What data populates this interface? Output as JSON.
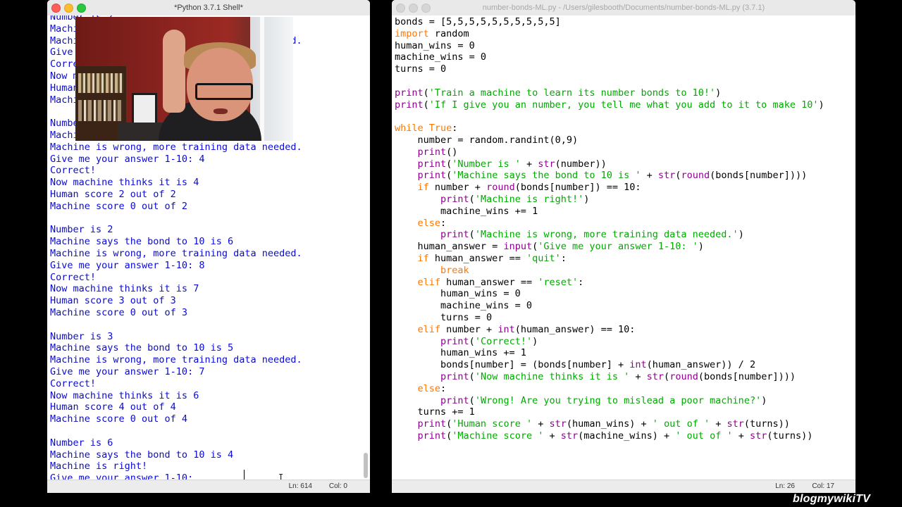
{
  "shell": {
    "title": "*Python 3.7.1 Shell*",
    "lines": [
      "Number is 2",
      "Machine says the bond to 10 is 5",
      "Machine is wrong, more training data needed.",
      "Give me your answer 1-10: 6",
      "Correct!",
      "Now machine thinks it is 6",
      "Human score 1 out of 1",
      "Machine score 0 out of 1",
      "",
      "Number is 6",
      "Machine says the bond to 10 is 5",
      "Machine is wrong, more training data needed.",
      "Give me your answer 1-10: 4",
      "Correct!",
      "Now machine thinks it is 4",
      "Human score 2 out of 2",
      "Machine score 0 out of 2",
      "",
      "Number is 2",
      "Machine says the bond to 10 is 6",
      "Machine is wrong, more training data needed.",
      "Give me your answer 1-10: 8",
      "Correct!",
      "Now machine thinks it is 7",
      "Human score 3 out of 3",
      "Machine score 0 out of 3",
      "",
      "Number is 3",
      "Machine says the bond to 10 is 5",
      "Machine is wrong, more training data needed.",
      "Give me your answer 1-10: 7",
      "Correct!",
      "Now machine thinks it is 6",
      "Human score 4 out of 4",
      "Machine score 0 out of 4",
      "",
      "Number is 6",
      "Machine says the bond to 10 is 4",
      "Machine is right!",
      "Give me your answer 1-10: "
    ],
    "status": {
      "ln": "Ln: 614",
      "col": "Col: 0"
    }
  },
  "editor": {
    "title": "number-bonds-ML.py - /Users/gilesbooth/Documents/number-bonds-ML.py (3.7.1)",
    "status": {
      "ln": "Ln: 26",
      "col": "Col: 17"
    },
    "code": [
      [
        [
          "d",
          "bonds = [5,5,5,5,5,5,5,5,5,5]"
        ]
      ],
      [
        [
          "k",
          "import"
        ],
        [
          "d",
          " random"
        ]
      ],
      [
        [
          "d",
          "human_wins = 0"
        ]
      ],
      [
        [
          "d",
          "machine_wins = 0"
        ]
      ],
      [
        [
          "d",
          "turns = 0"
        ]
      ],
      [],
      [
        [
          "b",
          "print"
        ],
        [
          "d",
          "("
        ],
        [
          "s",
          "'Train a machine to learn its number bonds to 10!'"
        ],
        [
          "d",
          ")"
        ]
      ],
      [
        [
          "b",
          "print"
        ],
        [
          "d",
          "("
        ],
        [
          "s",
          "'If I give you an number, you tell me what you add to it to make 10'"
        ],
        [
          "d",
          ")"
        ]
      ],
      [],
      [
        [
          "k",
          "while"
        ],
        [
          "d",
          " "
        ],
        [
          "k",
          "True"
        ],
        [
          "d",
          ":"
        ]
      ],
      [
        [
          "d",
          "    number = random.randint(0,9)"
        ]
      ],
      [
        [
          "d",
          "    "
        ],
        [
          "b",
          "print"
        ],
        [
          "d",
          "()"
        ]
      ],
      [
        [
          "d",
          "    "
        ],
        [
          "b",
          "print"
        ],
        [
          "d",
          "("
        ],
        [
          "s",
          "'Number is '"
        ],
        [
          "d",
          " + "
        ],
        [
          "b",
          "str"
        ],
        [
          "d",
          "(number))"
        ]
      ],
      [
        [
          "d",
          "    "
        ],
        [
          "b",
          "print"
        ],
        [
          "d",
          "("
        ],
        [
          "s",
          "'Machine says the bond to 10 is '"
        ],
        [
          "d",
          " + "
        ],
        [
          "b",
          "str"
        ],
        [
          "d",
          "("
        ],
        [
          "b",
          "round"
        ],
        [
          "d",
          "(bonds[number])))"
        ]
      ],
      [
        [
          "d",
          "    "
        ],
        [
          "k",
          "if"
        ],
        [
          "d",
          " number + "
        ],
        [
          "b",
          "round"
        ],
        [
          "d",
          "(bonds[number]) == 10:"
        ]
      ],
      [
        [
          "d",
          "        "
        ],
        [
          "b",
          "print"
        ],
        [
          "d",
          "("
        ],
        [
          "s",
          "'Machine is right!'"
        ],
        [
          "d",
          ")"
        ]
      ],
      [
        [
          "d",
          "        machine_wins += 1"
        ]
      ],
      [
        [
          "d",
          "    "
        ],
        [
          "k",
          "else"
        ],
        [
          "d",
          ":"
        ]
      ],
      [
        [
          "d",
          "        "
        ],
        [
          "b",
          "print"
        ],
        [
          "d",
          "("
        ],
        [
          "s",
          "'Machine is wrong, more training data needed.'"
        ],
        [
          "d",
          ")"
        ]
      ],
      [
        [
          "d",
          "    human_answer = "
        ],
        [
          "b",
          "input"
        ],
        [
          "d",
          "("
        ],
        [
          "s",
          "'Give me your answer 1-10: '"
        ],
        [
          "d",
          ")"
        ]
      ],
      [
        [
          "d",
          "    "
        ],
        [
          "k",
          "if"
        ],
        [
          "d",
          " human_answer == "
        ],
        [
          "s",
          "'quit'"
        ],
        [
          "d",
          ":"
        ]
      ],
      [
        [
          "d",
          "        "
        ],
        [
          "k",
          "break"
        ]
      ],
      [
        [
          "d",
          "    "
        ],
        [
          "k",
          "elif"
        ],
        [
          "d",
          " human_answer == "
        ],
        [
          "s",
          "'reset'"
        ],
        [
          "d",
          ":"
        ]
      ],
      [
        [
          "d",
          "        human_wins = 0"
        ]
      ],
      [
        [
          "d",
          "        machine_wins = 0"
        ]
      ],
      [
        [
          "d",
          "        turns = 0"
        ]
      ],
      [
        [
          "d",
          "    "
        ],
        [
          "k",
          "elif"
        ],
        [
          "d",
          " number + "
        ],
        [
          "b",
          "int"
        ],
        [
          "d",
          "(human_answer) == 10:"
        ]
      ],
      [
        [
          "d",
          "        "
        ],
        [
          "b",
          "print"
        ],
        [
          "d",
          "("
        ],
        [
          "s",
          "'Correct!'"
        ],
        [
          "d",
          ")"
        ]
      ],
      [
        [
          "d",
          "        human_wins += 1"
        ]
      ],
      [
        [
          "d",
          "        bonds[number] = (bonds[number] + "
        ],
        [
          "b",
          "int"
        ],
        [
          "d",
          "(human_answer)) / 2"
        ]
      ],
      [
        [
          "d",
          "        "
        ],
        [
          "b",
          "print"
        ],
        [
          "d",
          "("
        ],
        [
          "s",
          "'Now machine thinks it is '"
        ],
        [
          "d",
          " + "
        ],
        [
          "b",
          "str"
        ],
        [
          "d",
          "("
        ],
        [
          "b",
          "round"
        ],
        [
          "d",
          "(bonds[number])))"
        ]
      ],
      [
        [
          "d",
          "    "
        ],
        [
          "k",
          "else"
        ],
        [
          "d",
          ":"
        ]
      ],
      [
        [
          "d",
          "        "
        ],
        [
          "b",
          "print"
        ],
        [
          "d",
          "("
        ],
        [
          "s",
          "'Wrong! Are you trying to mislead a poor machine?'"
        ],
        [
          "d",
          ")"
        ]
      ],
      [
        [
          "d",
          "    turns += 1"
        ]
      ],
      [
        [
          "d",
          "    "
        ],
        [
          "b",
          "print"
        ],
        [
          "d",
          "("
        ],
        [
          "s",
          "'Human score '"
        ],
        [
          "d",
          " + "
        ],
        [
          "b",
          "str"
        ],
        [
          "d",
          "(human_wins) + "
        ],
        [
          "s",
          "' out of '"
        ],
        [
          "d",
          " + "
        ],
        [
          "b",
          "str"
        ],
        [
          "d",
          "(turns))"
        ]
      ],
      [
        [
          "d",
          "    "
        ],
        [
          "b",
          "print"
        ],
        [
          "d",
          "("
        ],
        [
          "s",
          "'Machine score '"
        ],
        [
          "d",
          " + "
        ],
        [
          "b",
          "str"
        ],
        [
          "d",
          "(machine_wins) + "
        ],
        [
          "s",
          "' out of '"
        ],
        [
          "d",
          " + "
        ],
        [
          "b",
          "str"
        ],
        [
          "d",
          "(turns))"
        ]
      ]
    ]
  },
  "colors": {
    "shell_output": "#0a0ad6",
    "keyword": "#ff7700",
    "builtin": "#900090",
    "string": "#00aa00",
    "default": "#000000"
  },
  "watermark": "blogmywikiTV"
}
